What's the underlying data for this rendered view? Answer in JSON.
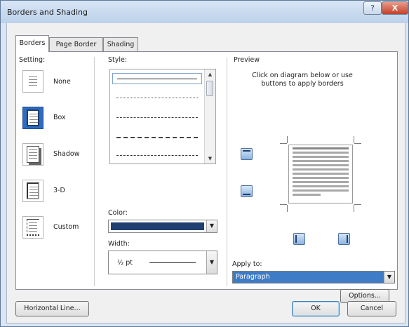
{
  "window": {
    "title": "Borders and Shading"
  },
  "titlebar": {
    "help_icon": "?",
    "close_icon": "X"
  },
  "tabs": [
    {
      "label": "Borders",
      "active": true
    },
    {
      "label": "Page Border",
      "active": false
    },
    {
      "label": "Shading",
      "active": false
    }
  ],
  "setting": {
    "label": "Setting:",
    "options": [
      {
        "label": "None",
        "selected": false
      },
      {
        "label": "Box",
        "selected": true
      },
      {
        "label": "Shadow",
        "selected": false
      },
      {
        "label": "3-D",
        "selected": false
      },
      {
        "label": "Custom",
        "selected": false
      }
    ]
  },
  "style": {
    "label": "Style:",
    "items": [
      "solid",
      "dotted",
      "dash-small",
      "dashed",
      "dash-dot"
    ],
    "selected_index": 0
  },
  "color": {
    "label": "Color:",
    "value": "#1f3f70"
  },
  "width": {
    "label": "Width:",
    "value": "½ pt"
  },
  "preview": {
    "label": "Preview",
    "instructions_line1": "Click on diagram below or use",
    "instructions_line2": "buttons to apply borders"
  },
  "apply_to": {
    "label": "Apply to:",
    "value": "Paragraph"
  },
  "buttons": {
    "options": "Options...",
    "horizontal_line": "Horizontal Line...",
    "ok": "OK",
    "cancel": "Cancel"
  },
  "colors": {
    "selection": "#3f7cc7",
    "accent": "#2f6bbf",
    "border_color": "#1f3f70"
  }
}
